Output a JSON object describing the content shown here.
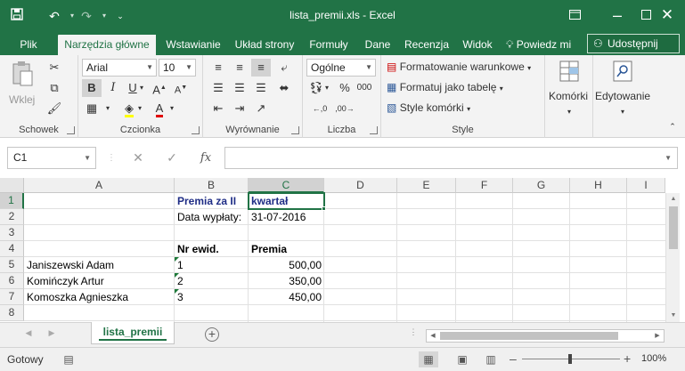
{
  "window": {
    "title": "lista_premii.xls - Excel",
    "save_icon": "save-icon",
    "undo_icon": "undo-icon",
    "redo_icon": "redo-icon",
    "accent": "#217346"
  },
  "tabs": [
    "Plik",
    "Narzędzia główne",
    "Wstawianie",
    "Układ strony",
    "Formuły",
    "Dane",
    "Recenzja",
    "Widok"
  ],
  "tell_me": "Powiedz mi",
  "share_label": "Udostępnij",
  "ribbon": {
    "clipboard": {
      "label": "Schowek",
      "paste": "Wklej"
    },
    "font": {
      "label": "Czcionka",
      "font_name": "Arial",
      "font_size": "10",
      "bold": "B",
      "italic": "I",
      "underline": "U"
    },
    "alignment": {
      "label": "Wyrównanie"
    },
    "number": {
      "label": "Liczba",
      "format": "Ogólne",
      "percent": "%",
      "comma": "000"
    },
    "styles": {
      "label": "Style",
      "conditional": "Formatowanie warunkowe",
      "as_table": "Formatuj jako tabelę",
      "cell_styles": "Style komórki"
    },
    "cells": {
      "label": "Komórki"
    },
    "editing": {
      "label": "Edytowanie"
    }
  },
  "formula_bar": {
    "name_box": "C1",
    "fx": "fx",
    "formula": ""
  },
  "columns": [
    "A",
    "B",
    "C",
    "D",
    "E",
    "F",
    "G",
    "H",
    "I"
  ],
  "rows": [
    "1",
    "2",
    "3",
    "4",
    "5",
    "6",
    "7",
    "8"
  ],
  "cells": {
    "B1": "Premia za II",
    "C1": "kwartał",
    "B2": "Data wypłaty:",
    "C2": "31-07-2016",
    "B4": "Nr ewid.",
    "C4": "Premia",
    "A5": "Janiszewski Adam",
    "B5": "1",
    "C5": "500,00",
    "A6": "Komińczyk Artur",
    "B6": "2",
    "C6": "350,00",
    "A7": "Komoszka Agnieszka",
    "B7": "3",
    "C7": "450,00"
  },
  "sheet": {
    "name": "lista_premii"
  },
  "status": {
    "ready": "Gotowy",
    "zoom": "100%"
  }
}
